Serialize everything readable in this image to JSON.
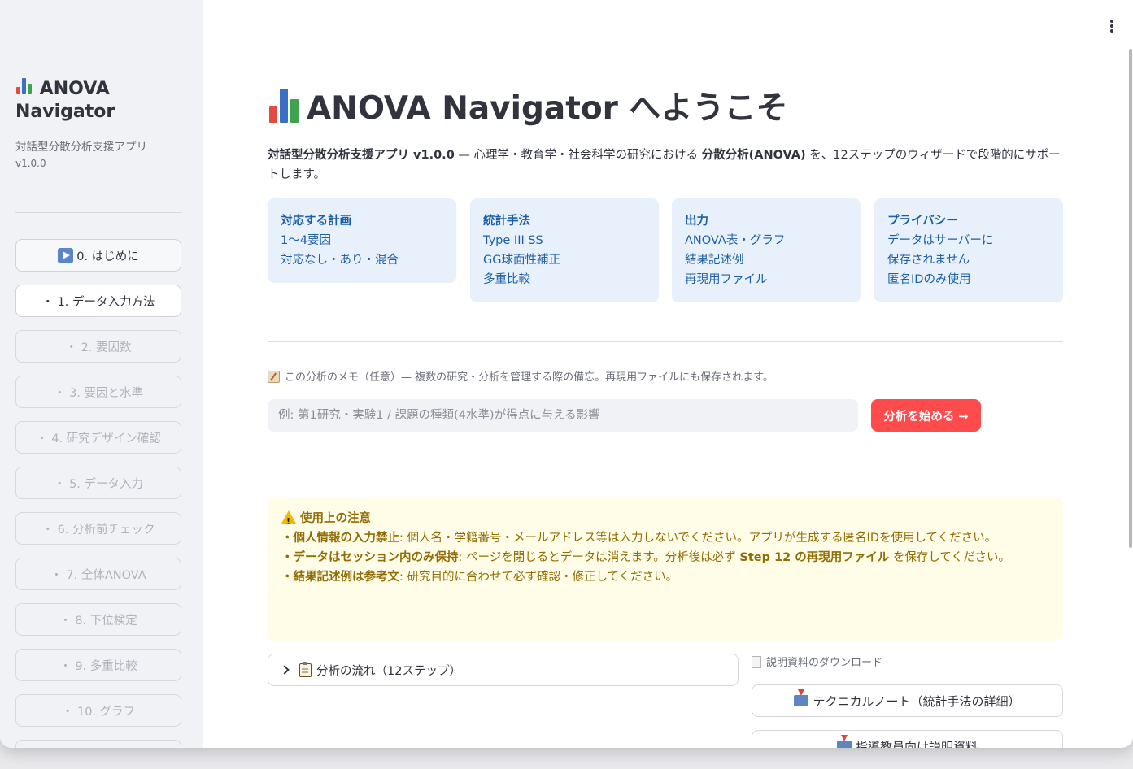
{
  "sidebar": {
    "title": "ANOVA Navigator",
    "subtitle": "対話型分散分析支援アプリ",
    "version": "v1.0.0",
    "nav": [
      "0. はじめに",
      "・ 1. データ入力方法",
      "・ 2. 要因数",
      "・ 3. 要因と水準",
      "・ 4. 研究デザイン確認",
      "・ 5. データ入力",
      "・ 6. 分析前チェック",
      "・ 7. 全体ANOVA",
      "・ 8. 下位検定",
      "・ 9. 多重比較",
      "・ 10. グラフ"
    ]
  },
  "main": {
    "title": "ANOVA Navigator へようこそ",
    "intro": {
      "app_name": "対話型分散分析支援アプリ v1.0.0",
      "t1": " — 心理学・教育学・社会科学の研究における ",
      "anova": "分散分析(ANOVA)",
      "t2": " を、12ステップのウィザードで段階的にサポートします。"
    },
    "cards": [
      {
        "title": "対応する計画",
        "lines": [
          "1〜4要因",
          "対応なし・あり・混合"
        ]
      },
      {
        "title": "統計手法",
        "lines": [
          "Type III SS",
          "GG球面性補正",
          "多重比較"
        ]
      },
      {
        "title": "出力",
        "lines": [
          "ANOVA表・グラフ",
          "結果記述例",
          "再現用ファイル"
        ]
      },
      {
        "title": "プライバシー",
        "lines": [
          "データはサーバーに",
          "保存されません",
          "匿名IDのみ使用"
        ]
      }
    ],
    "memo": {
      "label": "この分析のメモ（任意）— 複数の研究・分析を管理する際の備忘。再現用ファイルにも保存されます。",
      "placeholder": "例: 第1研究・実験1 / 課題の種類(4水準)が得点に与える影響"
    },
    "start_button": "分析を始める →",
    "warning": {
      "title": "使用上の注意",
      "items": [
        {
          "bold": "・個人情報の入力禁止",
          "text": ": 個人名・学籍番号・メールアドレス等は入力しないでください。アプリが生成する匿名IDを使用してください。"
        },
        {
          "bold": "・データはセッション内のみ保持",
          "text": ": ページを閉じるとデータは消えます。分析後は必ず ",
          "bold2": "Step 12 の再現用ファイル",
          "text2": " を保存してください。"
        },
        {
          "bold": "・結果記述例は参考文",
          "text": ": 研究目的に合わせて必ず確認・修正してください。"
        }
      ]
    },
    "expander": "分析の流れ（12ステップ）",
    "downloads": {
      "label": "説明資料のダウンロード",
      "buttons": [
        "テクニカルノート（統計手法の詳細）",
        "指導教員向け説明資料"
      ]
    }
  },
  "colors": {
    "accent": "#ff4b4b",
    "info_bg": "#e8f1fb",
    "info_text": "#1d5fa6",
    "warning_bg": "#fffce7",
    "warning_text": "#926c05"
  },
  "icons": {
    "title": "bar-chart-icon",
    "memo": "memo-icon",
    "warning": "warning-icon",
    "expander": "clipboard-icon",
    "download": "inbox-tray-icon"
  }
}
